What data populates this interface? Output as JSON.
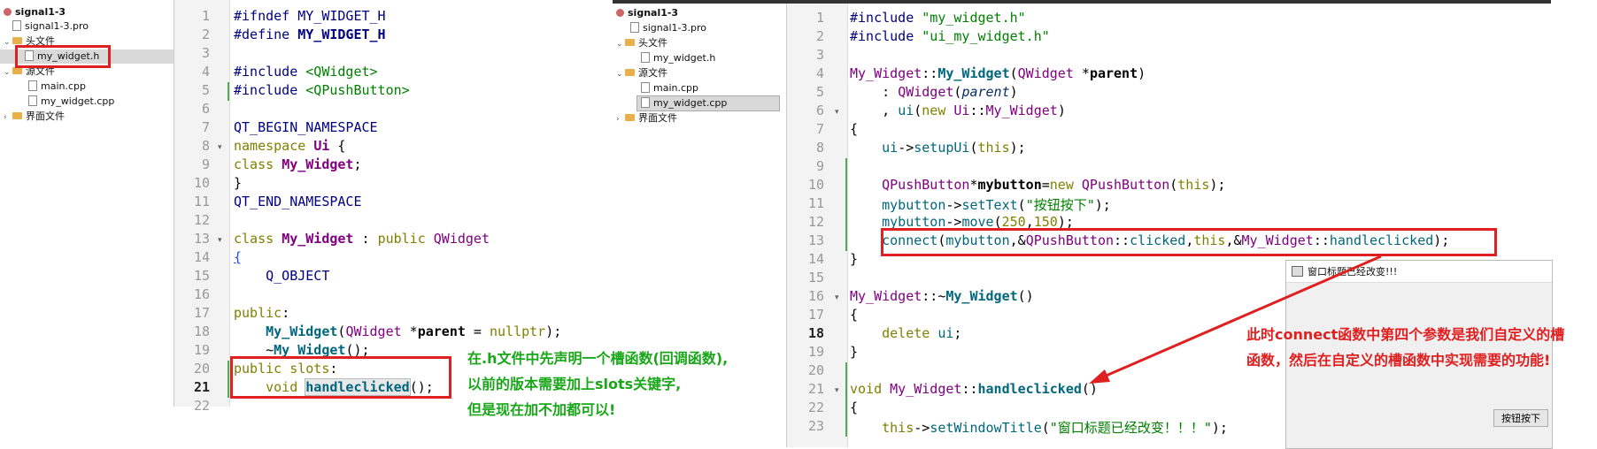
{
  "left": {
    "tree": {
      "project": "signal1-3",
      "pro_file": "signal1-3.pro",
      "headers_folder": "头文件",
      "header_file": "my_widget.h",
      "sources_folder": "源文件",
      "source_main": "main.cpp",
      "source_widget": "my_widget.cpp",
      "forms_folder": "界面文件"
    },
    "line_numbers": [
      "1",
      "2",
      "3",
      "4",
      "5",
      "6",
      "7",
      "8",
      "9",
      "10",
      "11",
      "12",
      "13",
      "14",
      "15",
      "16",
      "17",
      "18",
      "19",
      "20",
      "21",
      "22"
    ],
    "note": [
      "在.h文件中先声明一个槽函数(回调函数),",
      "以前的版本需要加上slots关键字,",
      "但是现在加不加都可以!"
    ]
  },
  "right": {
    "tree": {
      "project": "signal1-3",
      "pro_file": "signal1-3.pro",
      "headers_folder": "头文件",
      "header_file": "my_widget.h",
      "sources_folder": "源文件",
      "source_main": "main.cpp",
      "source_widget": "my_widget.cpp",
      "forms_folder": "界面文件"
    },
    "line_numbers": [
      "1",
      "2",
      "3",
      "4",
      "5",
      "6",
      "7",
      "8",
      "9",
      "10",
      "11",
      "12",
      "13",
      "14",
      "15",
      "16",
      "17",
      "18",
      "19",
      "20",
      "21",
      "22",
      "23"
    ],
    "popup": {
      "title": "窗口标题已经改变!!!",
      "button": "按钮按下"
    },
    "note": [
      "此时connect函数中第四个参数是我们自定义的槽",
      "函数，然后在自定义的槽函数中实现需要的功能!"
    ]
  },
  "colors": {
    "highlight_box": "#e02020",
    "note_green": "#19a619",
    "note_red": "#e02020"
  }
}
